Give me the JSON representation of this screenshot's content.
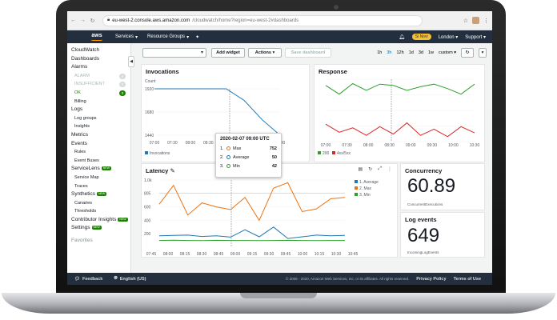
{
  "browser": {
    "url_host": "eu-west-2.console.aws.amazon.com",
    "url_path": "/cloudwatch/home?region=eu-west-2#dashboards"
  },
  "topnav": {
    "logo": "aws",
    "services": "Services",
    "resource_groups": "Resource Groups",
    "user": "Si Novi",
    "region": "London",
    "support": "Support"
  },
  "sidebar": {
    "cloudwatch": "CloudWatch",
    "dashboards": "Dashboards",
    "alarms": "Alarms",
    "alarm": {
      "label": "ALARM",
      "count": "0"
    },
    "insufficient": {
      "label": "INSUFFICIENT",
      "count": "0"
    },
    "ok": {
      "label": "OK",
      "count": "0"
    },
    "billing": "Billing",
    "logs": "Logs",
    "log_groups": "Log groups",
    "insights": "Insights",
    "metrics": "Metrics",
    "events": "Events",
    "rules": "Rules",
    "event_buses": "Event Buses",
    "servicelens": "ServiceLens",
    "service_map": "Service Map",
    "traces": "Traces",
    "synthetics": "Synthetics",
    "canaries": "Canaries",
    "thresholds": "Thresholds",
    "contributor_insights": "Contributor Insights",
    "settings": "Settings",
    "new_badge": "NEW",
    "favorites": "Favorites"
  },
  "toolbar": {
    "add_widget": "Add widget",
    "actions": "Actions",
    "save_dashboard": "Save dashboard",
    "ranges": [
      "1h",
      "3h",
      "12h",
      "1d",
      "3d",
      "1w",
      "custom"
    ],
    "selected_range": "3h"
  },
  "panels": {
    "invocations": {
      "title": "Invocations"
    },
    "response": {
      "title": "Response"
    },
    "latency": {
      "title": "Latency"
    },
    "concurrency": {
      "title": "Concurrency",
      "value": "60.89",
      "caption": "ConcurrentExecutions"
    },
    "log_events": {
      "title": "Log events",
      "value": "649",
      "caption": "IncomingLogEvents"
    }
  },
  "tooltip": {
    "title": "2020-02-07 09:00 UTC",
    "rows": [
      {
        "n": "1.",
        "label": "Max",
        "value": "752",
        "color": "#ec7211"
      },
      {
        "n": "2.",
        "label": "Average",
        "value": "50",
        "color": "#1f77b4"
      },
      {
        "n": "3.",
        "label": "Min",
        "value": "42",
        "color": "#2ca02c"
      }
    ]
  },
  "footer": {
    "feedback": "Feedback",
    "language": "English (US)",
    "copyright": "© 2008 - 2020, Amazon Web Services, Inc. or its affiliates. All rights reserved.",
    "privacy": "Privacy Policy",
    "terms": "Terms of Use"
  },
  "chart_data": [
    {
      "type": "line",
      "title": "Invocations",
      "ylabel": "Count",
      "x": [
        "07:00",
        "07:30",
        "08:00",
        "08:30",
        "09:00",
        "09:30",
        "10:00",
        "10:30"
      ],
      "yticks": [
        "1440",
        "1680",
        "1920"
      ],
      "ylim": [
        1440,
        1920
      ],
      "series": [
        {
          "name": "Invocations",
          "color": "#1f77b4",
          "values": [
            1920,
            1920,
            1920,
            1920,
            1920,
            1800,
            1600,
            1440
          ]
        }
      ],
      "legend": "bottom-left"
    },
    {
      "type": "line",
      "title": "Response",
      "x": [
        "07:00",
        "07:30",
        "08:00",
        "08:30",
        "09:00",
        "09:30",
        "10:00",
        "10:30"
      ],
      "ylim": [
        0,
        100
      ],
      "series": [
        {
          "name": "200",
          "color": "#2ca02c",
          "values": [
            90,
            76,
            93,
            82,
            92,
            90,
            82,
            88,
            92,
            85,
            76,
            92
          ]
        },
        {
          "name": "4xx/5xx",
          "color": "#d62728",
          "values": [
            28,
            15,
            22,
            10,
            24,
            12,
            30,
            10,
            20,
            8,
            24,
            14
          ]
        }
      ],
      "legend": "bottom-left"
    },
    {
      "type": "line",
      "title": "Latency",
      "x": [
        "07:45",
        "08:00",
        "08:15",
        "08:30",
        "08:45",
        "09:00",
        "09:15",
        "09:30",
        "09:45",
        "10:00",
        "10:15",
        "10:30",
        "10:45"
      ],
      "yticks": [
        "200",
        "400",
        "600",
        "805",
        "1.0k"
      ],
      "ylim": [
        0,
        1000
      ],
      "threshold": 805,
      "series": [
        {
          "name": "1. Average",
          "color": "#1f77b4",
          "values": [
            170,
            175,
            180,
            160,
            170,
            150,
            260,
            155,
            300,
            130,
            155,
            180,
            170,
            175
          ]
        },
        {
          "name": "2. Max",
          "color": "#ec7211",
          "values": [
            640,
            920,
            480,
            660,
            600,
            560,
            740,
            400,
            880,
            960,
            530,
            570,
            720,
            740
          ]
        },
        {
          "name": "3. Min",
          "color": "#2ca02c",
          "values": [
            100,
            105,
            100,
            98,
            102,
            100,
            100,
            98,
            100,
            102,
            100,
            98,
            100,
            100
          ]
        }
      ],
      "legend": "top-right"
    }
  ]
}
